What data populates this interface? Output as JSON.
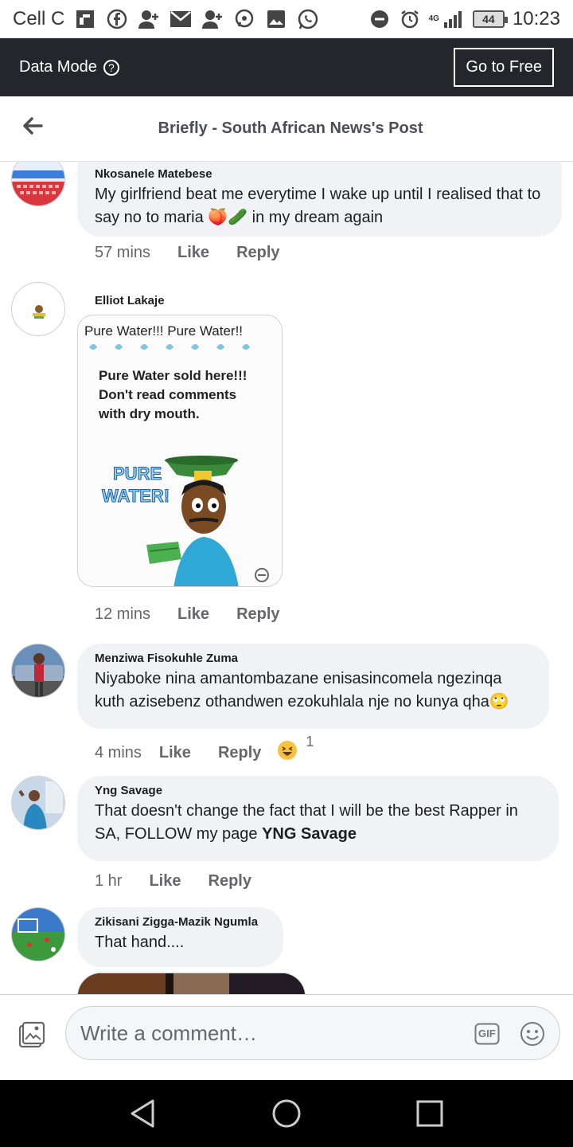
{
  "status_bar": {
    "carrier": "Cell C",
    "battery": "44",
    "network": "4G",
    "time": "10:23"
  },
  "data_bar": {
    "label": "Data Mode",
    "help_icon": "?",
    "go_free": "Go to Free"
  },
  "header": {
    "title": "Briefly - South African News's Post"
  },
  "comments": [
    {
      "author": "Nkosanele Matebese",
      "text": "My girlfriend beat me everytime I wake up until I realised that to say no to maria 🍑🥒 in my dream again",
      "time": "57 mins",
      "like": "Like",
      "reply": "Reply"
    },
    {
      "author": "Elliot Lakaje",
      "image_text": {
        "top": "Pure Water!!! Pure Water!!",
        "line1": "Pure Water sold here!!!",
        "line2": "Don't read comments",
        "line3": "with dry mouth.",
        "badge1": "PURE",
        "badge2": "WATER!"
      },
      "time": "12 mins",
      "like": "Like",
      "reply": "Reply"
    },
    {
      "author": "Menziwa Fisokuhle Zuma",
      "text": "Niyaboke nina amantombazane enisasincomela ngezinqa kuth azisebenz othandwen ezokuhlala nje no kunya qha🙄",
      "time": "4 mins",
      "like": "Like",
      "reply": "Reply",
      "reaction_count": "1"
    },
    {
      "author": "Yng Savage",
      "text": "That doesn't change the fact that I will be the best Rapper in SA, FOLLOW my page ",
      "text_bold": "YNG Savage",
      "time": "1 hr",
      "like": "Like",
      "reply": "Reply"
    },
    {
      "author": "Zikisani Zigga-Mazik Ngumla",
      "text": "That hand....",
      "time": "",
      "like": "",
      "reply": ""
    }
  ],
  "composer": {
    "placeholder": "Write a comment…",
    "gif_label": "GIF"
  }
}
